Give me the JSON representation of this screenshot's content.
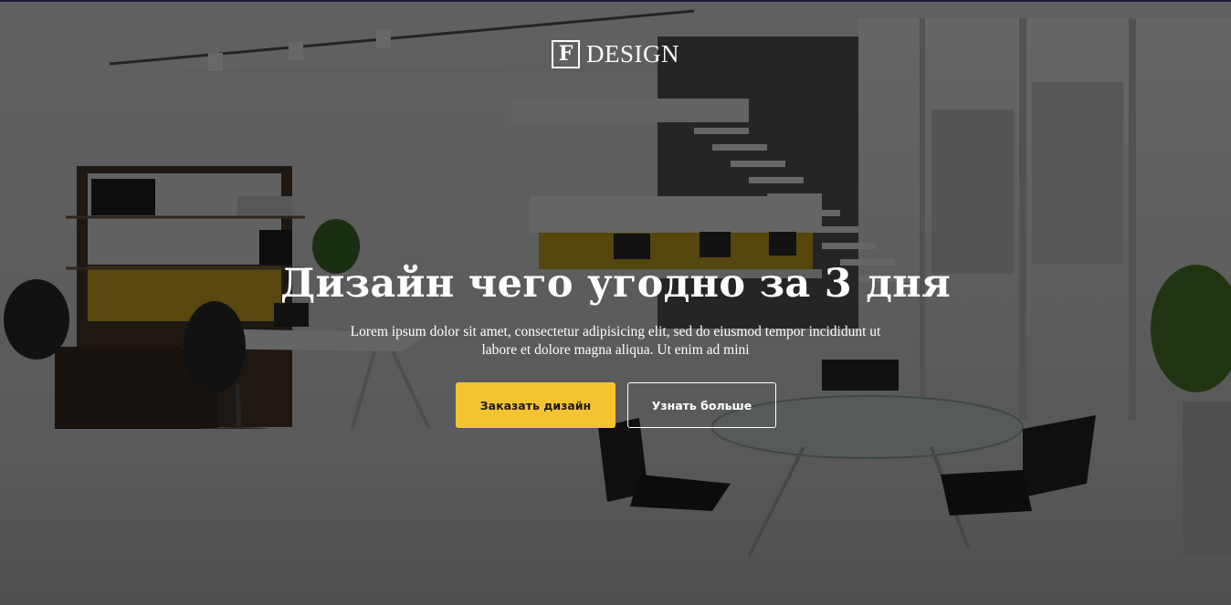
{
  "brand": {
    "logo_letter": "F",
    "logo_text": "DESIGN"
  },
  "hero": {
    "title": "Дизайн чего угодно за 3 дня",
    "subtitle": "Lorem ipsum dolor sit amet, consectetur adipisicing elit, sed do eiusmod tempor incididunt ut labore et dolore magna aliqua. Ut enim ad mini",
    "primary_button": "Заказать дизайн",
    "secondary_button": "Узнать больше"
  },
  "colors": {
    "accent": "#f4c331",
    "text": "#ffffff",
    "overlay": "rgba(0,0,0,0.58)"
  },
  "background": {
    "icon": "office-interior-photo"
  }
}
